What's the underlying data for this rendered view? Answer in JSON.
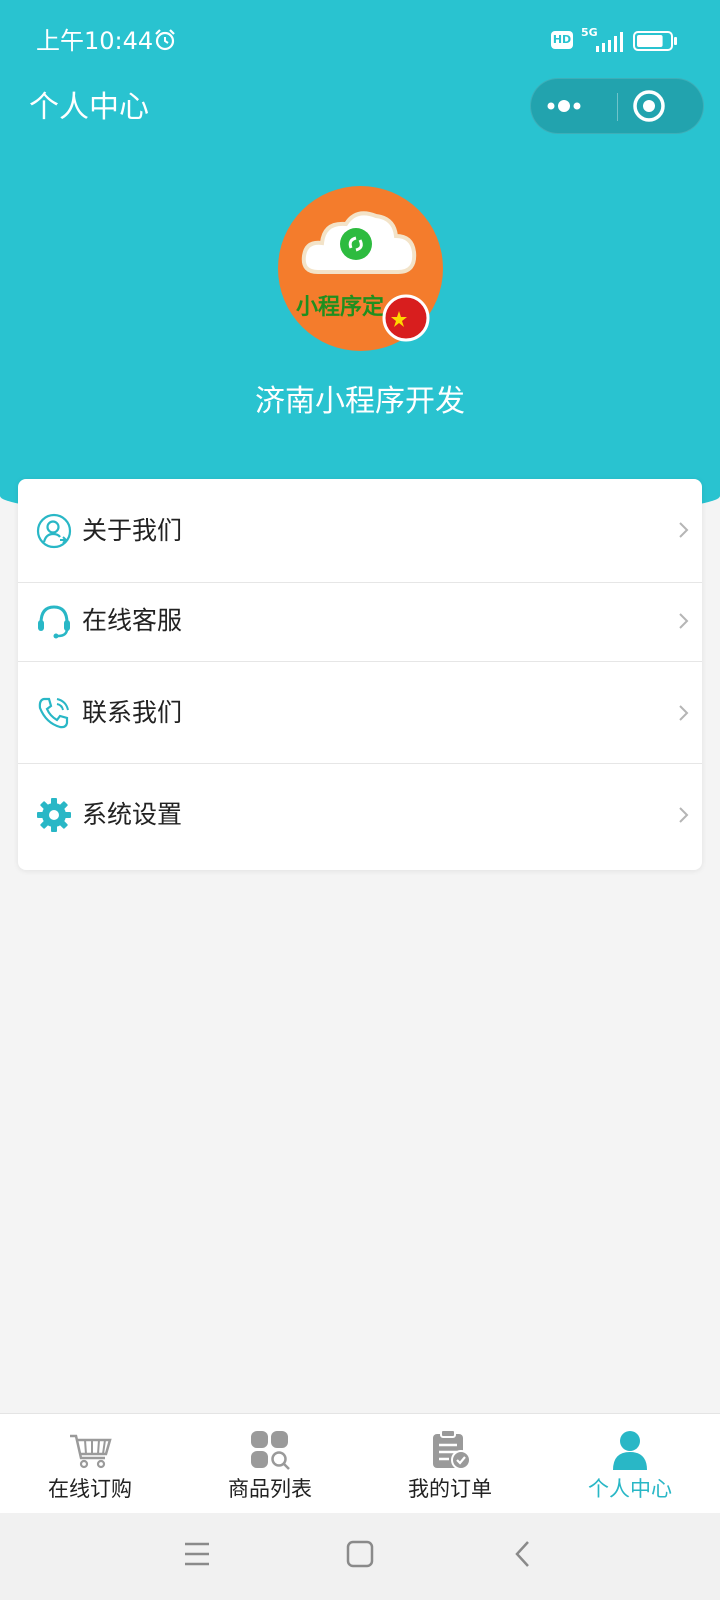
{
  "status_bar": {
    "time": "上午10:44",
    "hd": "HD",
    "network": "5G",
    "battery_level": 0.8
  },
  "nav": {
    "title": "个人中心"
  },
  "profile": {
    "avatar_text": "小程序定",
    "name": "济南小程序开发"
  },
  "menu": [
    {
      "label": "关于我们",
      "icon": "user-icon"
    },
    {
      "label": "在线客服",
      "icon": "headset-icon"
    },
    {
      "label": "联系我们",
      "icon": "phone-icon"
    },
    {
      "label": "系统设置",
      "icon": "gear-icon"
    }
  ],
  "tabbar": [
    {
      "label": "在线订购",
      "icon": "cart-icon",
      "active": false
    },
    {
      "label": "商品列表",
      "icon": "grid-search-icon",
      "active": false
    },
    {
      "label": "我的订单",
      "icon": "order-clipboard-icon",
      "active": false
    },
    {
      "label": "个人中心",
      "icon": "person-icon",
      "active": true
    }
  ],
  "colors": {
    "brand": "#29c3d0",
    "active_tab": "#29b7c6",
    "avatar_bg": "#f47c2c"
  }
}
